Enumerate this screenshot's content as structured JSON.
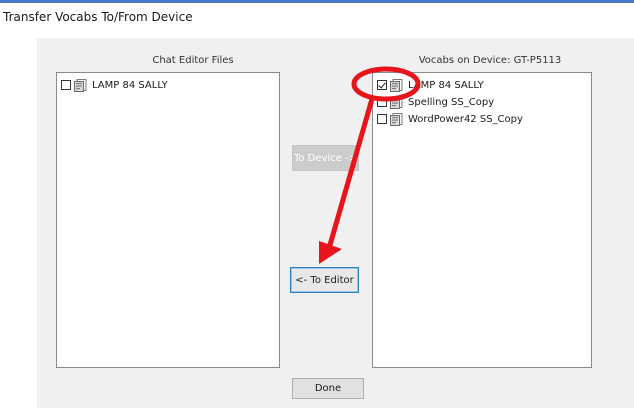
{
  "window": {
    "title": "Transfer Vocabs To/From Device"
  },
  "left_panel": {
    "label": "Chat Editor Files",
    "items": [
      {
        "label": "LAMP 84 SALLY",
        "checked": false,
        "icon": "vocab-file-icon"
      }
    ]
  },
  "right_panel": {
    "label": "Vocabs on Device: GT-P5113",
    "items": [
      {
        "label": "LAMP 84 SALLY",
        "checked": true,
        "icon": "vocab-file-icon"
      },
      {
        "label": "Spelling SS_Copy",
        "checked": false,
        "icon": "vocab-file-icon"
      },
      {
        "label": "WordPower42 SS_Copy",
        "checked": false,
        "icon": "vocab-file-icon"
      }
    ]
  },
  "buttons": {
    "to_device": {
      "label": "To Device ->",
      "enabled": false
    },
    "to_editor": {
      "label": "<- To Editor",
      "enabled": true,
      "focused": true
    },
    "done": {
      "label": "Done",
      "enabled": true
    }
  },
  "annotation": {
    "color": "#e8141c",
    "shapes": [
      "ellipse-highlight",
      "arrow"
    ]
  }
}
